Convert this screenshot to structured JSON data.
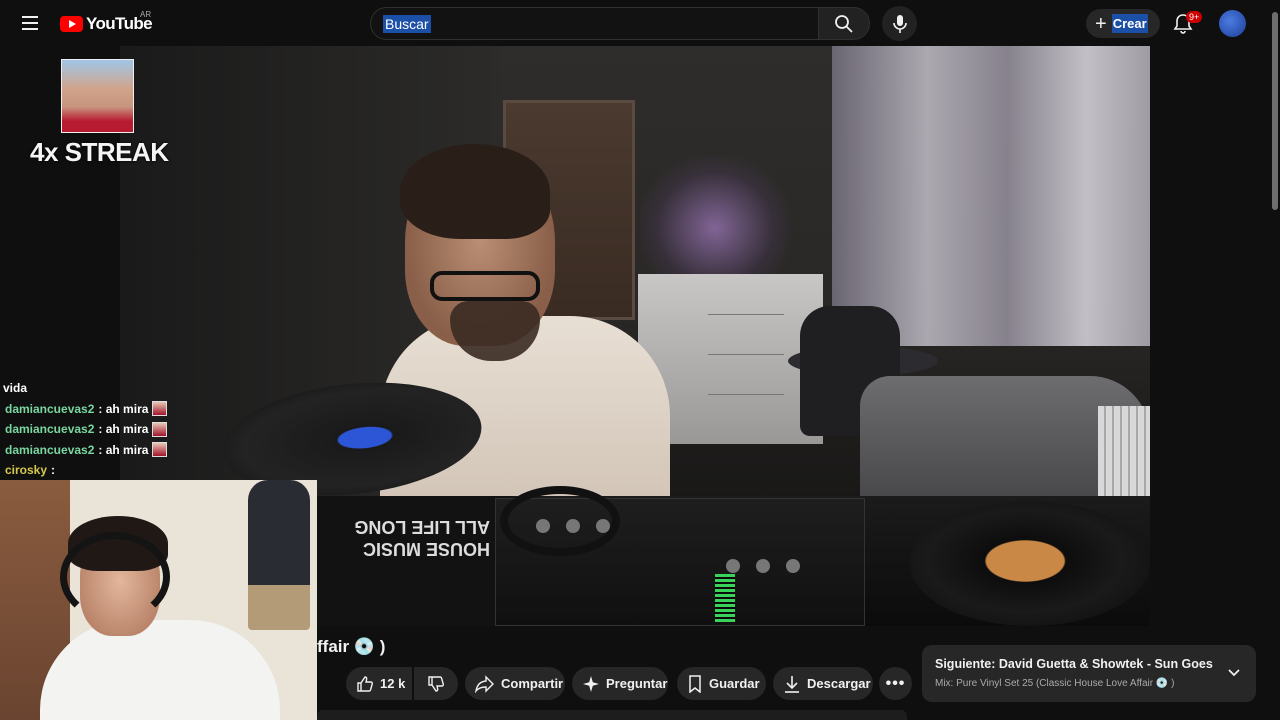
{
  "header": {
    "logo_text": "YouTube",
    "country_code": "AR",
    "search_placeholder": "Buscar",
    "create_label": "Crear",
    "notifications_badge": "9+"
  },
  "overlay": {
    "streak_text": "4x STREAK",
    "chat": [
      {
        "user": "",
        "message": "vida"
      },
      {
        "user": "damiancuevas2",
        "message": ": ah mira"
      },
      {
        "user": "damiancuevas2",
        "message": ": ah mira"
      },
      {
        "user": "damiancuevas2",
        "message": ": ah mira"
      },
      {
        "user": "cirosky",
        "message": ":"
      }
    ]
  },
  "video": {
    "platter_text": "HOUSE MUSIC ALL LIFE LONG",
    "title_visible": "ffair 💿 )"
  },
  "actions": {
    "like_count": "12 k",
    "share": "Compartir",
    "ask": "Preguntar",
    "save": "Guardar",
    "download": "Descargar"
  },
  "upnext": {
    "title": "Siguiente: David Guetta & Showtek - Sun Goes Dow...",
    "subtitle": "Mix: Pure Vinyl Set 25 (Classic House Love Affair 💿 )"
  },
  "colors": {
    "background": "#0f0f0f",
    "pill": "#272727",
    "brand_red": "#ff0000",
    "selection_blue": "#1c4fa6",
    "chat_user": "#7ad6a0"
  },
  "icons": [
    "hamburger-icon",
    "youtube-logo-icon",
    "search-icon",
    "mic-icon",
    "plus-icon",
    "bell-icon",
    "like-icon",
    "dislike-icon",
    "share-icon",
    "sparkle-icon",
    "bookmark-icon",
    "download-icon",
    "more-icon",
    "chevron-down-icon"
  ]
}
